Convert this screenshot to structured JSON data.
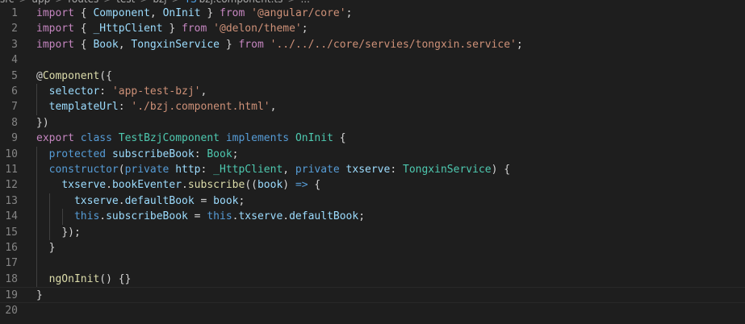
{
  "breadcrumb": {
    "items": [
      "src",
      "app",
      "routes",
      "test",
      "bzj",
      "bzj.component.ts",
      "..."
    ],
    "file_icon": "TS"
  },
  "editor": {
    "lines": [
      {
        "n": "1",
        "tokens": [
          [
            "import",
            "ctl"
          ],
          [
            " { ",
            "pun"
          ],
          [
            "Component",
            "var"
          ],
          [
            ", ",
            "pun"
          ],
          [
            "OnInit",
            "var"
          ],
          [
            " } ",
            "pun"
          ],
          [
            "from",
            "ctl"
          ],
          [
            " ",
            "pun"
          ],
          [
            "'@angular/core'",
            "str"
          ],
          [
            ";",
            "pun"
          ]
        ]
      },
      {
        "n": "2",
        "tokens": [
          [
            "import",
            "ctl"
          ],
          [
            " { ",
            "pun"
          ],
          [
            "_HttpClient",
            "var"
          ],
          [
            " } ",
            "pun"
          ],
          [
            "from",
            "ctl"
          ],
          [
            " ",
            "pun"
          ],
          [
            "'@delon/theme'",
            "str"
          ],
          [
            ";",
            "pun"
          ]
        ]
      },
      {
        "n": "3",
        "tokens": [
          [
            "import",
            "ctl"
          ],
          [
            " { ",
            "pun"
          ],
          [
            "Book",
            "var"
          ],
          [
            ", ",
            "pun"
          ],
          [
            "TongxinService",
            "var"
          ],
          [
            " } ",
            "pun"
          ],
          [
            "from",
            "ctl"
          ],
          [
            " ",
            "pun"
          ],
          [
            "'../../../core/servies/tongxin.service'",
            "str"
          ],
          [
            ";",
            "pun"
          ]
        ]
      },
      {
        "n": "4",
        "tokens": []
      },
      {
        "n": "5",
        "tokens": [
          [
            "@",
            "dec"
          ],
          [
            "Component",
            "fn"
          ],
          [
            "({",
            "pun"
          ]
        ]
      },
      {
        "n": "6",
        "tokens": [
          [
            "  ",
            "pun"
          ],
          [
            "selector",
            "var"
          ],
          [
            ": ",
            "pun"
          ],
          [
            "'app-test-bzj'",
            "str"
          ],
          [
            ",",
            "pun"
          ]
        ]
      },
      {
        "n": "7",
        "tokens": [
          [
            "  ",
            "pun"
          ],
          [
            "templateUrl",
            "var"
          ],
          [
            ": ",
            "pun"
          ],
          [
            "'./bzj.component.html'",
            "str"
          ],
          [
            ",",
            "pun"
          ]
        ]
      },
      {
        "n": "8",
        "tokens": [
          [
            "})",
            "pun"
          ]
        ]
      },
      {
        "n": "9",
        "tokens": [
          [
            "export",
            "ctl"
          ],
          [
            " ",
            "pun"
          ],
          [
            "class",
            "kw"
          ],
          [
            " ",
            "pun"
          ],
          [
            "TestBzjComponent",
            "cls"
          ],
          [
            " ",
            "pun"
          ],
          [
            "implements",
            "kw"
          ],
          [
            " ",
            "pun"
          ],
          [
            "OnInit",
            "cls"
          ],
          [
            " {",
            "pun"
          ]
        ]
      },
      {
        "n": "10",
        "tokens": [
          [
            "  ",
            "pun"
          ],
          [
            "protected",
            "kw"
          ],
          [
            " ",
            "pun"
          ],
          [
            "subscribeBook",
            "var"
          ],
          [
            ": ",
            "pun"
          ],
          [
            "Book",
            "cls"
          ],
          [
            ";",
            "pun"
          ]
        ]
      },
      {
        "n": "11",
        "tokens": [
          [
            "  ",
            "pun"
          ],
          [
            "constructor",
            "kw"
          ],
          [
            "(",
            "pun"
          ],
          [
            "private",
            "kw"
          ],
          [
            " ",
            "pun"
          ],
          [
            "http",
            "var"
          ],
          [
            ": ",
            "pun"
          ],
          [
            "_HttpClient",
            "cls"
          ],
          [
            ", ",
            "pun"
          ],
          [
            "private",
            "kw"
          ],
          [
            " ",
            "pun"
          ],
          [
            "txserve",
            "var"
          ],
          [
            ": ",
            "pun"
          ],
          [
            "TongxinService",
            "cls"
          ],
          [
            ") {",
            "pun"
          ]
        ]
      },
      {
        "n": "12",
        "tokens": [
          [
            "    ",
            "pun"
          ],
          [
            "txserve",
            "var"
          ],
          [
            ".",
            "pun"
          ],
          [
            "bookEventer",
            "var"
          ],
          [
            ".",
            "pun"
          ],
          [
            "subscribe",
            "fn"
          ],
          [
            "((",
            "pun"
          ],
          [
            "book",
            "var"
          ],
          [
            ") ",
            "pun"
          ],
          [
            "=>",
            "kw"
          ],
          [
            " {",
            "pun"
          ]
        ]
      },
      {
        "n": "13",
        "tokens": [
          [
            "      ",
            "pun"
          ],
          [
            "txserve",
            "var"
          ],
          [
            ".",
            "pun"
          ],
          [
            "defaultBook",
            "var"
          ],
          [
            " = ",
            "pun"
          ],
          [
            "book",
            "var"
          ],
          [
            ";",
            "pun"
          ]
        ]
      },
      {
        "n": "14",
        "tokens": [
          [
            "      ",
            "pun"
          ],
          [
            "this",
            "kw"
          ],
          [
            ".",
            "pun"
          ],
          [
            "subscribeBook",
            "var"
          ],
          [
            " = ",
            "pun"
          ],
          [
            "this",
            "kw"
          ],
          [
            ".",
            "pun"
          ],
          [
            "txserve",
            "var"
          ],
          [
            ".",
            "pun"
          ],
          [
            "defaultBook",
            "var"
          ],
          [
            ";",
            "pun"
          ]
        ]
      },
      {
        "n": "15",
        "tokens": [
          [
            "    ",
            "pun"
          ],
          [
            "});",
            "pun"
          ]
        ]
      },
      {
        "n": "16",
        "tokens": [
          [
            "  ",
            "pun"
          ],
          [
            "}",
            "pun"
          ]
        ]
      },
      {
        "n": "17",
        "tokens": []
      },
      {
        "n": "18",
        "tokens": [
          [
            "  ",
            "pun"
          ],
          [
            "ngOnInit",
            "fn"
          ],
          [
            "() {}",
            "pun"
          ]
        ]
      },
      {
        "n": "19",
        "tokens": [
          [
            "}",
            "pun"
          ]
        ]
      },
      {
        "n": "20",
        "tokens": []
      }
    ],
    "current_line": "19",
    "colors": {
      "background": "#1e1e1e",
      "keyword": "#569cd6",
      "control": "#c586c0",
      "string": "#ce9178",
      "type": "#4ec9b0",
      "variable": "#9cdcfe",
      "function": "#dcdcaa"
    }
  }
}
